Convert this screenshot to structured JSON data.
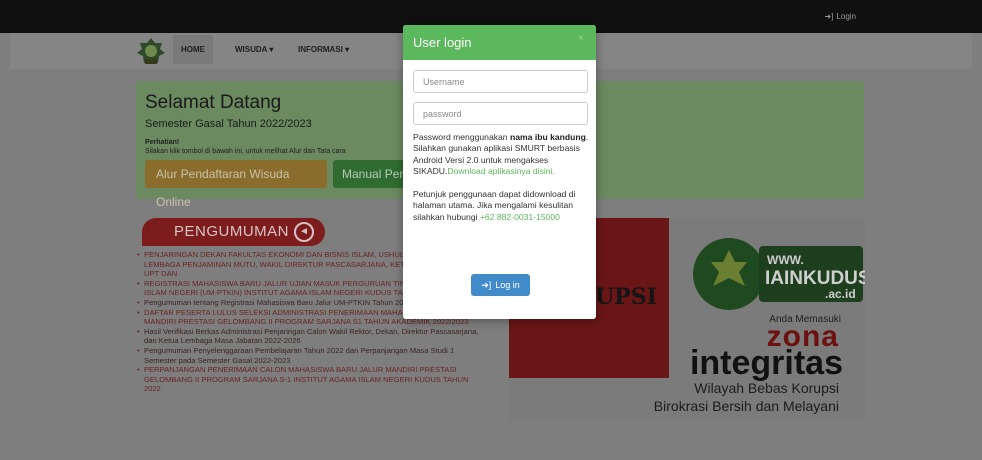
{
  "topbar": {
    "login_label": "Login",
    "login_icon": "sign-in-icon"
  },
  "nav": {
    "home": "HOME",
    "wisuda": "WISUDA",
    "informasi": "INFORMASI",
    "caret": "▾"
  },
  "jumbotron": {
    "title": "Selamat Datang",
    "subtitle": "Semester Gasal Tahun 2022/2023",
    "notice_label": "Perhatian!",
    "notice_text": "Silakan klik tombol di bawah ini, untuk melihat Alur dan Tata cara",
    "button_alur": "Alur Pendaftaran Wisuda Online",
    "button_manual": "Manual Pen"
  },
  "announcements": {
    "heading": "PENGUMUMAN",
    "items": [
      "PENJARINGAN DEKAN FAKULTAS EKONOMI DAN BISNIS ISLAM, USHULUDDIN, KETUA LEMBAGA PENJAMINAN MUTU, WAKIL DIREKTUR PASCASARJANA, KETUA PRODI, KEPALA UPT DAN",
      "REGISTRASI MAHASISWA BARU JALUR UJIAN MASUK PERGURUAN TINGGI KEAGAMAAN ISLAM NEGERI (UM-PTKIN) INSTITUT AGAMA ISLAM NEGERI KUDUS TAHUN 2022",
      "Pengumuman tentang Registrasi Mahasiswa Baru Jalur UM-PTKIN Tahun 2022",
      "DAFTAR PESERTA LULUS SELEKSI ADMINISTRASI PENERIMAAN MAHASISWA BARU JALUR MANDIRI PRESTASI GELOMBANG II PROGRAM SARJANA S1 TAHUN AKADEMIK 2022/2023",
      "Hasil Verifikasi Berkas Administrasi Penjaringan Calon Wakil Rektor, Dekan, Direktur Pascasarjana, dan Ketua Lembaga Masa Jabatan 2022-2026",
      "Pengumuman Penyelenggaraan Pembelajaran Tahun 2022 dan Perpanjangan Masa Studi 1 Semester pada Semester Gasal 2022-2023",
      "PERPANJANGAN PENERIMAAN CALON MAHASISWA BARU JALUR MANDIRI PRESTASI GELOMBANG II PROGRAM SARJANA S-1 INSTITUT AGAMA ISLAM NEGERI KUDUS TAHUN 2022"
    ]
  },
  "banner": {
    "partial_text": "UPSI",
    "site_www": "WWW.",
    "site_name": "IAINKUDUS",
    "site_tld": ".ac.id",
    "entering": "Anda Memasuki",
    "zona": "zona",
    "integritas": "integritas",
    "line1": "Wilayah Bebas Korupsi",
    "line2": "Birokrasi Bersih dan Melayani"
  },
  "modal": {
    "title": "User login",
    "close": "×",
    "username_placeholder": "Username",
    "password_placeholder": "password",
    "info1_pre": "Password menggunakan ",
    "info1_bold": "nama ibu kandung",
    "info1_post": ".",
    "info2": "Silahkan gunakan aplikasi SMURT berbasis Android Versi 2.0 untuk mengakses SIKADU.",
    "info2_link": "Download aplikasinya disini.",
    "info3": "Petunjuk penggunaan dapat didownload di halaman utama. Jika mengalami kesulitan silahkan hubungi ",
    "info3_phone": "+62 882-0031-15000",
    "login_button": "Log in",
    "login_icon": "sign-in-icon"
  },
  "colors": {
    "modal_header": "#5cb85c",
    "login_button": "#428bca",
    "overlay": "#7f7f7f",
    "announcement_red": "#7d1c1c"
  }
}
